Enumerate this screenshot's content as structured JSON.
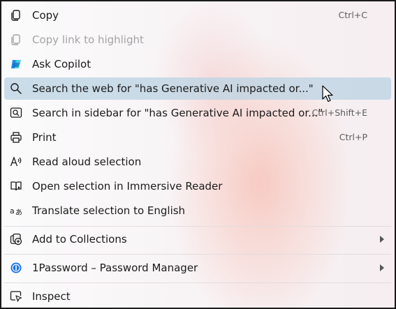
{
  "menu": {
    "copy": {
      "label": "Copy",
      "shortcut": "Ctrl+C",
      "icon": "copy-icon"
    },
    "copy_link": {
      "label": "Copy link to highlight",
      "icon": "link-icon",
      "disabled": true
    },
    "ask_copilot": {
      "label": "Ask Copilot",
      "icon": "copilot-icon"
    },
    "search_web": {
      "label": "Search the web for \"has Generative AI impacted or...\"",
      "icon": "search-icon",
      "highlighted": true
    },
    "search_sidebar": {
      "label": "Search in sidebar for \"has Generative AI impacted or...\"",
      "shortcut": "Ctrl+Shift+E",
      "icon": "sidebar-search-icon"
    },
    "print": {
      "label": "Print",
      "shortcut": "Ctrl+P",
      "icon": "printer-icon"
    },
    "read_aloud": {
      "label": "Read aloud selection",
      "icon": "read-aloud-icon"
    },
    "immersive_reader": {
      "label": "Open selection in Immersive Reader",
      "icon": "immersive-reader-icon"
    },
    "translate": {
      "label": "Translate selection to English",
      "icon": "translate-icon"
    },
    "collections": {
      "label": "Add to Collections",
      "icon": "collections-icon",
      "submenu": true
    },
    "onepassword": {
      "label": "1Password – Password Manager",
      "icon": "1password-icon",
      "submenu": true
    },
    "inspect": {
      "label": "Inspect",
      "icon": "inspect-icon"
    }
  },
  "colors": {
    "highlight": "#c9dbe8",
    "text": "#1b1b1b",
    "disabled_text": "#a3a3a6",
    "copilot_blue": "#1976e6",
    "onepassword_blue": "#1a73e8"
  }
}
